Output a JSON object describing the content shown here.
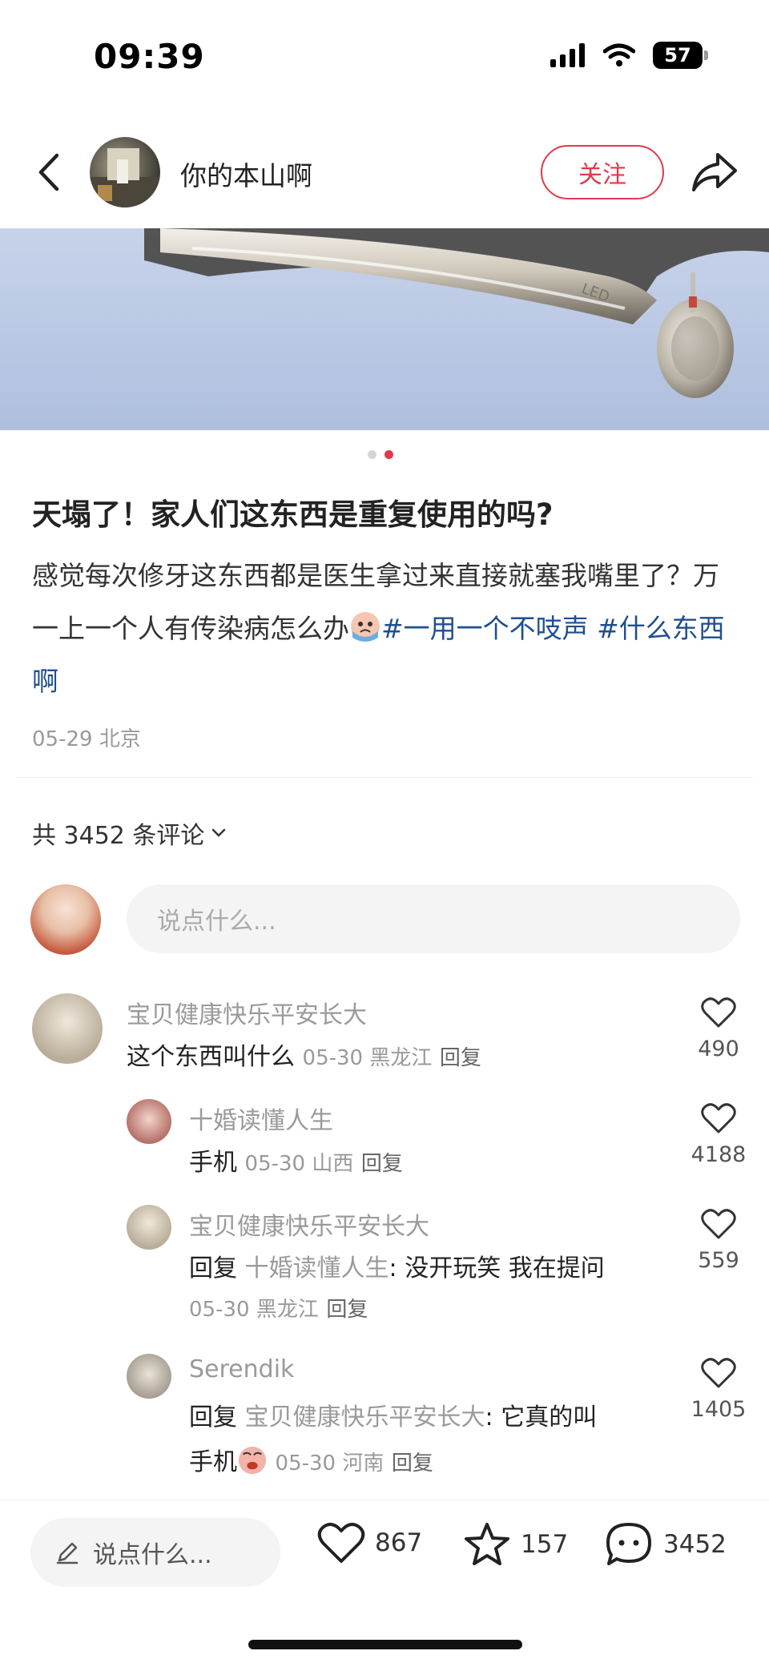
{
  "status_bar": {
    "time": "09:39",
    "battery": "57"
  },
  "author": {
    "name": "你的本山啊",
    "follow_label": "关注"
  },
  "post": {
    "title": "天塌了！家人们这东西是重复使用的吗?",
    "body": "感觉每次修牙这东西都是医生拿过来直接就塞我嘴里了？万一上一个人有传染病怎么办",
    "tags": [
      "#一用一个不吱声",
      "#什么东西啊"
    ],
    "meta": "05-29 北京",
    "image_dots": 2,
    "image_active_dot": 2
  },
  "comments_header": {
    "label": "共 3452 条评论"
  },
  "compose": {
    "placeholder": "说点什么..."
  },
  "comments": [
    {
      "name": "宝贝健康快乐平安长大",
      "text": "这个东西叫什么",
      "meta": "05-30 黑龙江",
      "reply": "回复",
      "likes": "490"
    },
    {
      "name": "十婚读懂人生",
      "text": "手机",
      "meta": "05-30 山西",
      "reply": "回复",
      "likes": "4188"
    },
    {
      "name": "宝贝健康快乐平安长大",
      "prefix": "回复",
      "reply_to": "十婚读懂人生",
      "text": ": 没开玩笑 我在提问",
      "meta": "05-30 黑龙江",
      "reply": "回复",
      "likes": "559"
    },
    {
      "name": "Serendik",
      "prefix": "回复",
      "reply_to": "宝贝健康快乐平安长大",
      "text": ": 它真的叫",
      "text2": "手机",
      "meta": "05-30 河南",
      "reply": "回复",
      "likes": "1405"
    }
  ],
  "bottom_bar": {
    "placeholder": "说点什么...",
    "likes": "867",
    "favorites": "157",
    "comments": "3452"
  },
  "colors": {
    "accent": "#e03a4b",
    "tag": "#1f4f8f"
  }
}
